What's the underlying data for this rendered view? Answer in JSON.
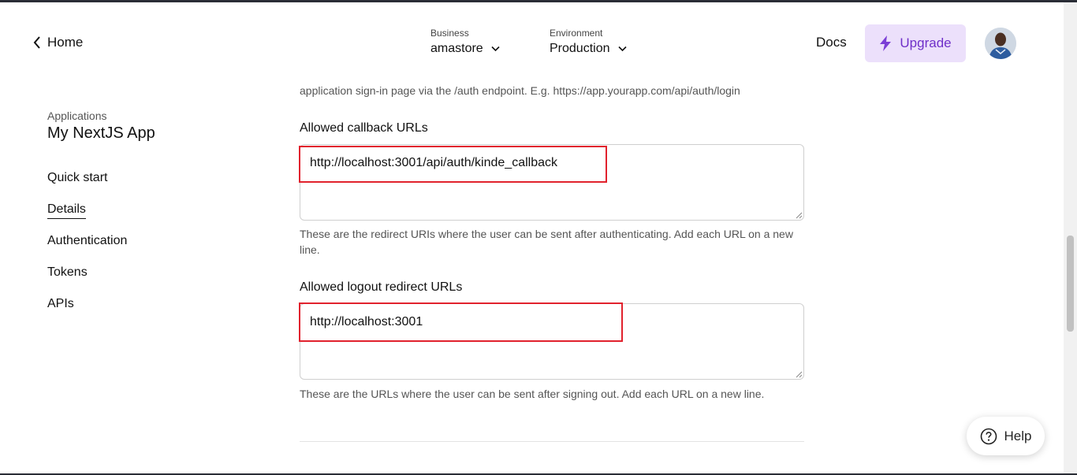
{
  "header": {
    "back_label": "Home",
    "business": {
      "label": "Business",
      "value": "amastore"
    },
    "environment": {
      "label": "Environment",
      "value": "Production"
    },
    "docs_label": "Docs",
    "upgrade_label": "Upgrade"
  },
  "sidebar": {
    "section_label": "Applications",
    "app_name": "My NextJS App",
    "items": [
      {
        "label": "Quick start"
      },
      {
        "label": "Details"
      },
      {
        "label": "Authentication"
      },
      {
        "label": "Tokens"
      },
      {
        "label": "APIs"
      }
    ]
  },
  "main": {
    "intro_text": "application sign-in page via the /auth endpoint. E.g. https://app.yourapp.com/api/auth/login",
    "callback": {
      "label": "Allowed callback URLs",
      "value": "http://localhost:3001/api/auth/kinde_callback",
      "help": "These are the redirect URIs where the user can be sent after authenticating. Add each URL on a new line."
    },
    "logout": {
      "label": "Allowed logout redirect URLs",
      "value": "http://localhost:3001",
      "help": "These are the URLs where the user can be sent after signing out. Add each URL on a new line."
    }
  },
  "help_label": "Help",
  "colors": {
    "accent": "#6f2fc9",
    "accent_bg": "#ece0fb",
    "highlight": "#e1222d"
  },
  "icons": [
    "chevron-left-icon",
    "chevron-down-icon",
    "lightning-icon",
    "help-circle-icon",
    "resize-grip-icon"
  ]
}
